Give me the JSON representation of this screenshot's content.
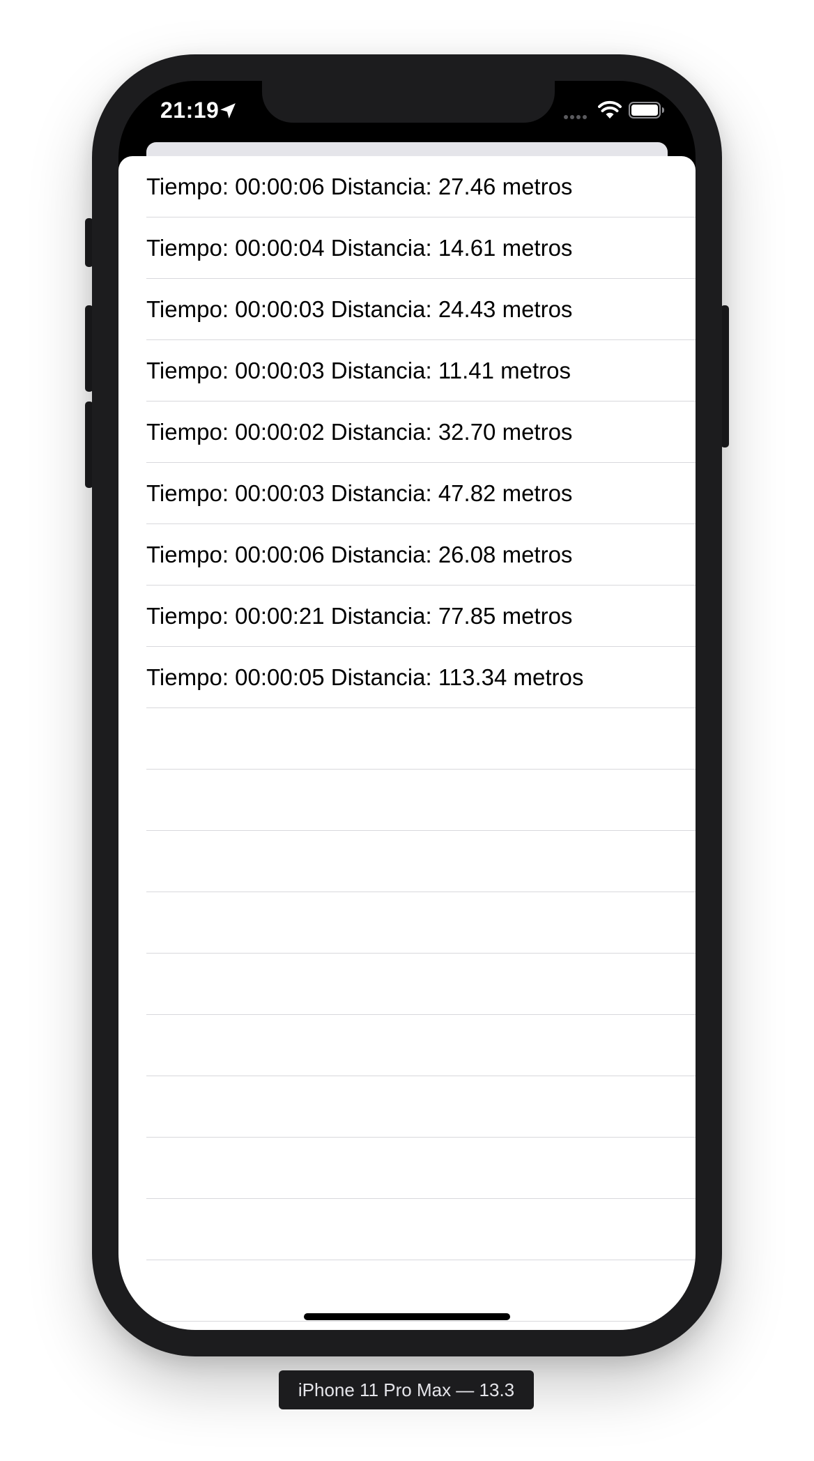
{
  "status_bar": {
    "time": "21:19",
    "icons": [
      "location-arrow-icon",
      "cellular-signal-icon",
      "wifi-icon",
      "battery-icon"
    ]
  },
  "list": {
    "rows": [
      "Tiempo: 00:00:06 Distancia: 27.46 metros",
      "Tiempo: 00:00:04 Distancia: 14.61 metros",
      "Tiempo: 00:00:03 Distancia: 24.43 metros",
      "Tiempo: 00:00:03 Distancia: 11.41 metros",
      "Tiempo: 00:00:02 Distancia: 32.70 metros",
      "Tiempo: 00:00:03 Distancia: 47.82 metros",
      "Tiempo: 00:00:06 Distancia: 26.08 metros",
      "Tiempo: 00:00:21 Distancia: 77.85 metros",
      "Tiempo: 00:00:05 Distancia: 113.34 metros",
      "",
      "",
      "",
      "",
      "",
      "",
      "",
      "",
      "",
      ""
    ]
  },
  "device": {
    "label": "iPhone 11 Pro Max — 13.3"
  },
  "colors": {
    "device_frame": "#1c1c1e",
    "background": "#ffffff",
    "separator": "#d8d8dc",
    "text": "#000000"
  }
}
